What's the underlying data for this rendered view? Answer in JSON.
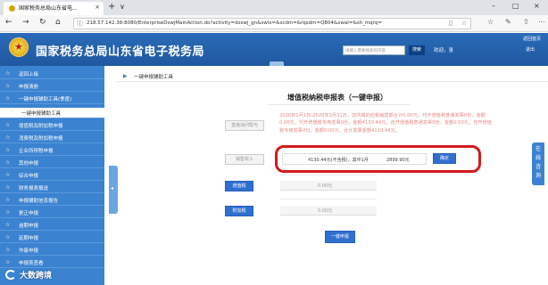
{
  "browser": {
    "tab_title": "国家税务总局山东省电...",
    "tab_close": "×",
    "new_tab": "+",
    "tab_dropdown": "∨",
    "minimize": "–",
    "maximize": "□",
    "close": "×",
    "back": "←",
    "forward": "→",
    "refresh": "↻",
    "home": "⌂",
    "info": "ⓘ",
    "url": "218.57.142.38:8080/EnterpriseDswjMainAction.do?activity=dzswj_gn&swlx=&scdm=&rqsdm=Q804&xwal=&sh_mqrq="
  },
  "header": {
    "site_title": "国家税务总局山东省电子税务局",
    "search_placeholder": "请输入需要搜索的内容",
    "search_button": "搜索",
    "welcome": "欢迎，张",
    "back_home": "返回首页",
    "exit": "退出"
  },
  "sidebar": {
    "items": [
      {
        "label": "返回上级"
      },
      {
        "label": "申报清册"
      },
      {
        "label": "一键申报辅助工具(季度)"
      },
      {
        "label": "一键申报辅助工具"
      },
      {
        "label": "增值税及附加税申报"
      },
      {
        "label": "消费税及附加税申报"
      },
      {
        "label": "企业所得税申报"
      },
      {
        "label": "其他申报"
      },
      {
        "label": "综合申报"
      },
      {
        "label": "财务报表报送"
      },
      {
        "label": "申报辅助信息报告"
      },
      {
        "label": "更正申报"
      },
      {
        "label": "逾期申报"
      },
      {
        "label": "延期申报"
      },
      {
        "label": "作废申报"
      },
      {
        "label": "申报表查看"
      }
    ]
  },
  "breadcrumb": "一键申报辅助工具",
  "form": {
    "title": "增值税纳税申报表（一键申报）",
    "info_button": "直接询问帮与",
    "info_text": "2020年1月1日-2020年3月31日，您所属的应税销售额合计0.00元，代开增值税普通发票0份，金额0.00元，代开增值税专用发票0份，金额4130.44元，自开增值税普通发票0份，金额0.00元，自开增值税专用发票0份，金额0.00元，合计发票金额4130.44元。",
    "income_button": "销售收入",
    "income_value": "4130.44元(不含税)，其中1月",
    "income_value2": "2899.90元",
    "confirm_button": "确定",
    "vat_button": "增值税",
    "vat_value": "0.00元",
    "surtax_button": "附加税",
    "surtax_value": "0.00元",
    "submit_button": "一键申报"
  },
  "right_tab": "在线咨询",
  "watermark": "大数跨境"
}
